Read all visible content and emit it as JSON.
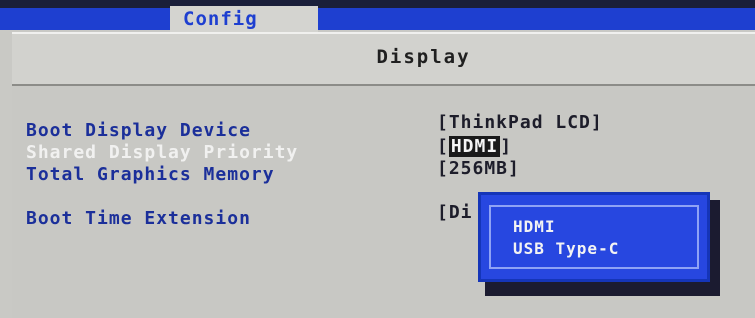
{
  "tabs": {
    "active": "Config"
  },
  "section": {
    "title": "Display"
  },
  "settings": [
    {
      "label": "Boot Display Device",
      "value": "[ThinkPad LCD]"
    },
    {
      "label": "Shared Display Priority",
      "value_prefix": "[",
      "value_selected": "HDMI",
      "value_suffix": "]"
    },
    {
      "label": "Total Graphics Memory",
      "value": "[256MB]"
    },
    {
      "label": "Boot Time Extension",
      "value": "[Di"
    }
  ],
  "popup": {
    "options": [
      "HDMI",
      "USB Type-C"
    ]
  },
  "colors": {
    "top_bar": "#1e3fd0",
    "label_blue": "#1b2f9a",
    "background_gray": "#c8c8c4",
    "popup_blue": "#2747e0"
  }
}
